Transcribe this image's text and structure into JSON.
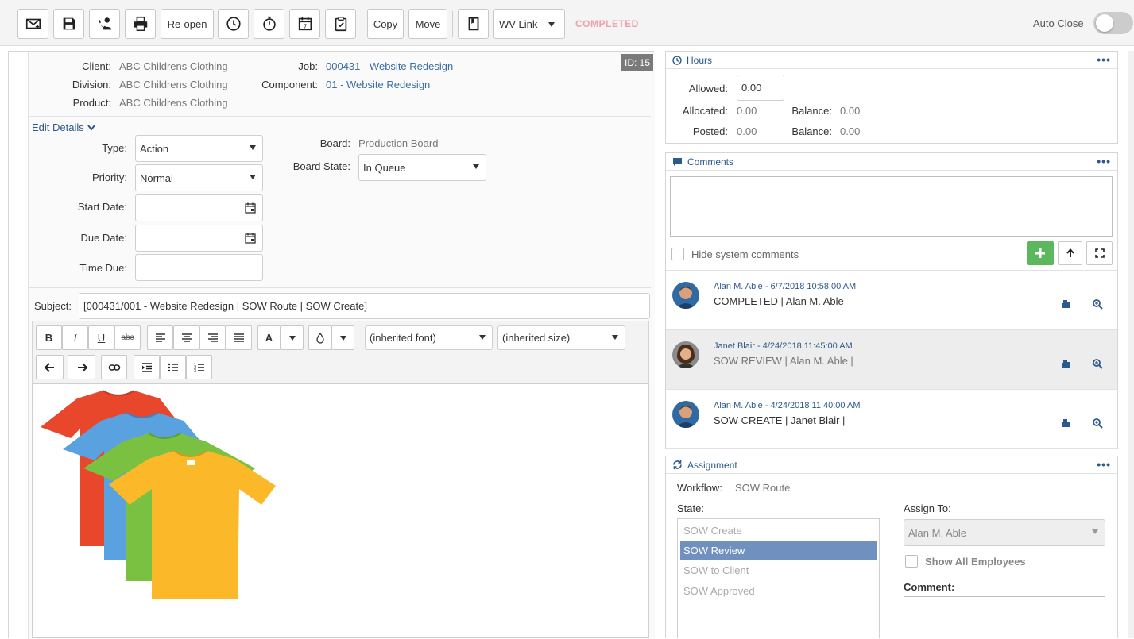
{
  "toolbar": {
    "reopen_label": "Re-open",
    "copy_label": "Copy",
    "move_label": "Move",
    "wv_link_label": "WV Link",
    "status": "COMPLETED",
    "auto_close_label": "Auto Close",
    "auto_close_on": false,
    "icons": [
      "email-icon",
      "save-icon",
      "phone-contact-icon",
      "print-icon",
      "clock-icon",
      "stopwatch-icon",
      "calendar-icon",
      "clipboard-check-icon",
      "book-icon"
    ]
  },
  "details": {
    "client_label": "Client:",
    "client_value": "ABC Childrens Clothing",
    "division_label": "Division:",
    "division_value": "ABC Childrens Clothing",
    "product_label": "Product:",
    "product_value": "ABC Childrens Clothing",
    "job_label": "Job:",
    "job_value": "000431 - Website Redesign",
    "component_label": "Component:",
    "component_value": "01 - Website Redesign",
    "id_badge": "ID: 15",
    "edit_details": "Edit Details",
    "type_label": "Type:",
    "type_value": "Action",
    "priority_label": "Priority:",
    "priority_value": "Normal",
    "start_date_label": "Start Date:",
    "due_date_label": "Due Date:",
    "time_due_label": "Time Due:",
    "board_label": "Board:",
    "board_value": "Production Board",
    "board_state_label": "Board State:",
    "board_state_value": "In Queue",
    "subject_label": "Subject:",
    "subject_value": "[000431/001 - Website Redesign | SOW Route | SOW Create]"
  },
  "editor": {
    "bold": "B",
    "italic": "I",
    "underline": "U",
    "strike": "abc",
    "font_color": "A",
    "font_family": "(inherited font)",
    "font_size": "(inherited size)"
  },
  "hours": {
    "title": "Hours",
    "allowed_label": "Allowed:",
    "allowed_value": "0.00",
    "allocated_label": "Allocated:",
    "allocated_value": "0.00",
    "balance1_label": "Balance:",
    "balance1_value": "0.00",
    "posted_label": "Posted:",
    "posted_value": "0.00",
    "balance2_label": "Balance:",
    "balance2_value": "0.00"
  },
  "comments": {
    "title": "Comments",
    "hide_system": "Hide system comments",
    "items": [
      {
        "author": "Alan M. Able - 6/7/2018 10:58:00 AM",
        "text": "COMPLETED | Alan M. Able"
      },
      {
        "author": "Janet Blair - 4/24/2018 11:45:00 AM",
        "text": "SOW REVIEW | Alan M. Able |"
      },
      {
        "author": "Alan M. Able - 4/24/2018 11:40:00 AM",
        "text": "SOW CREATE | Janet Blair |"
      }
    ]
  },
  "assignment": {
    "title": "Assignment",
    "workflow_label": "Workflow:",
    "workflow_value": "SOW Route",
    "state_label": "State:",
    "states": [
      "SOW Create",
      "SOW Review",
      "SOW to Client",
      "SOW Approved"
    ],
    "selected_state": "SOW Review",
    "assign_to_label": "Assign To:",
    "assign_to_value": "Alan M. Able",
    "show_all_label": "Show All Employees",
    "comment_label": "Comment:"
  },
  "colors": {
    "accent_blue": "#2d5a8c",
    "status_pink": "#f0a0ac",
    "add_green": "#5cb85c",
    "selected_state": "#7090c0"
  }
}
